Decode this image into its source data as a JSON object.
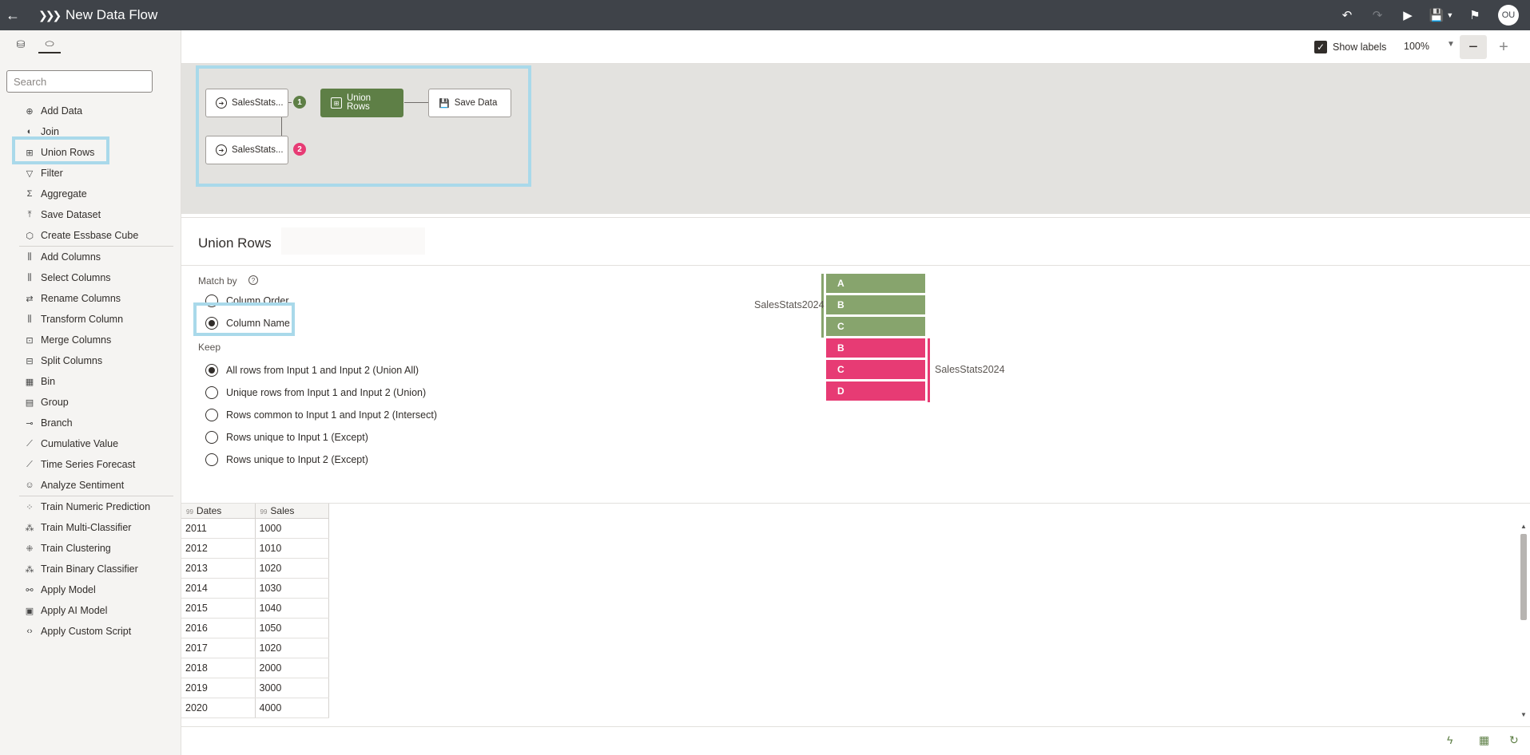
{
  "app": {
    "title": "New Data Flow",
    "avatar": "OU"
  },
  "left_panel": {
    "search_placeholder": "Search",
    "groups": [
      [
        {
          "label": "Add Data",
          "icon": "add-data-icon",
          "glyph": "⊕"
        },
        {
          "label": "Join",
          "icon": "join-icon",
          "glyph": "◐"
        },
        {
          "label": "Union Rows",
          "icon": "union-rows-icon",
          "glyph": "⊞"
        },
        {
          "label": "Filter",
          "icon": "filter-icon",
          "glyph": "▽"
        },
        {
          "label": "Aggregate",
          "icon": "sigma-icon",
          "glyph": "Σ"
        },
        {
          "label": "Save Dataset",
          "icon": "upload-icon",
          "glyph": "⤒"
        },
        {
          "label": "Create Essbase Cube",
          "icon": "cube-icon",
          "glyph": "⬡"
        }
      ],
      [
        {
          "label": "Add Columns",
          "icon": "add-columns-icon",
          "glyph": "⫼"
        },
        {
          "label": "Select Columns",
          "icon": "select-columns-icon",
          "glyph": "⫼"
        },
        {
          "label": "Rename Columns",
          "icon": "rename-columns-icon",
          "glyph": "⇄"
        },
        {
          "label": "Transform Column",
          "icon": "transform-column-icon",
          "glyph": "⫼"
        },
        {
          "label": "Merge Columns",
          "icon": "merge-columns-icon",
          "glyph": "⊡"
        },
        {
          "label": "Split Columns",
          "icon": "split-columns-icon",
          "glyph": "⊟"
        },
        {
          "label": "Bin",
          "icon": "bin-icon",
          "glyph": "▦"
        },
        {
          "label": "Group",
          "icon": "group-icon",
          "glyph": "▤"
        },
        {
          "label": "Branch",
          "icon": "branch-icon",
          "glyph": "⊸"
        },
        {
          "label": "Cumulative Value",
          "icon": "cumulative-icon",
          "glyph": "⟋"
        },
        {
          "label": "Time Series Forecast",
          "icon": "forecast-icon",
          "glyph": "⟋"
        },
        {
          "label": "Analyze Sentiment",
          "icon": "sentiment-icon",
          "glyph": "☺"
        }
      ],
      [
        {
          "label": "Train Numeric Prediction",
          "icon": "scatter-icon",
          "glyph": "⁘"
        },
        {
          "label": "Train Multi-Classifier",
          "icon": "classifier-icon",
          "glyph": "⁂"
        },
        {
          "label": "Train Clustering",
          "icon": "clustering-icon",
          "glyph": "⁜"
        },
        {
          "label": "Train Binary Classifier",
          "icon": "binary-classifier-icon",
          "glyph": "⁂"
        },
        {
          "label": "Apply Model",
          "icon": "apply-model-icon",
          "glyph": "⚯"
        },
        {
          "label": "Apply AI Model",
          "icon": "ai-model-icon",
          "glyph": "▣"
        },
        {
          "label": "Apply Custom Script",
          "icon": "code-icon",
          "glyph": "‹›"
        }
      ]
    ]
  },
  "toolbar": {
    "show_labels": "Show labels",
    "zoom": "100%"
  },
  "flow": {
    "source1": "SalesStats...",
    "source2": "SalesStats...",
    "badge1": "1",
    "badge2": "2",
    "union_line1": "Union",
    "union_line2": "Rows",
    "save": "Save Data"
  },
  "config": {
    "title": "Union Rows",
    "match_by_label": "Match by",
    "match_options": [
      "Column Order",
      "Column Name"
    ],
    "match_selected": 1,
    "keep_label": "Keep",
    "keep_options": [
      "All rows from Input 1 and Input 2 (Union All)",
      "Unique rows from Input 1 and Input 2 (Union)",
      "Rows common to Input 1 and Input 2 (Intersect)",
      "Rows unique to Input 1 (Except)",
      "Rows unique to Input 2 (Except)"
    ],
    "keep_selected": 0,
    "input1": {
      "name": "SalesStats2024",
      "columns": [
        "A",
        "B",
        "C"
      ],
      "color": "#87a46d"
    },
    "input2": {
      "name": "SalesStats2024",
      "columns": [
        "B",
        "C",
        "D"
      ],
      "color": "#e73b74"
    }
  },
  "grid": {
    "type_glyph": "99",
    "columns": [
      "Dates",
      "Sales"
    ],
    "rows": [
      [
        "2011",
        "1000"
      ],
      [
        "2012",
        "1010"
      ],
      [
        "2013",
        "1020"
      ],
      [
        "2014",
        "1030"
      ],
      [
        "2015",
        "1040"
      ],
      [
        "2016",
        "1050"
      ],
      [
        "2017",
        "1020"
      ],
      [
        "2018",
        "2000"
      ],
      [
        "2019",
        "3000"
      ],
      [
        "2020",
        "4000"
      ]
    ]
  },
  "colors": {
    "topbar": "#3f4349",
    "union_node": "#5e7f46",
    "input1": "#87a46d",
    "input2": "#e73b74",
    "highlight": "#a9d9ea"
  }
}
